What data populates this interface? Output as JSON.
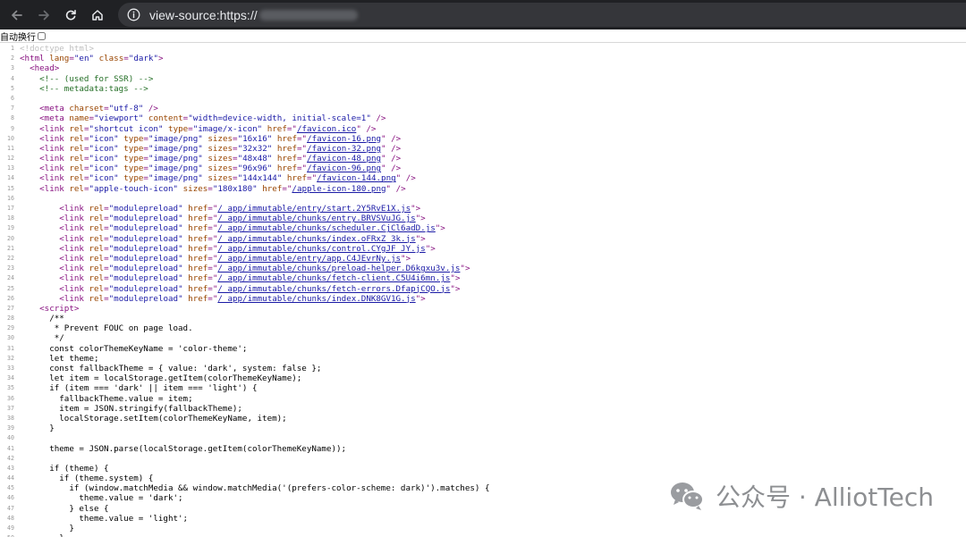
{
  "browser": {
    "url": "view-source:https://",
    "icons": {
      "back": "arrow-left-icon",
      "forward": "arrow-right-icon",
      "reload": "reload-icon",
      "home": "home-icon",
      "info": "info-icon"
    }
  },
  "wrap": {
    "label": "自动换行",
    "checked": false
  },
  "source_lines": [
    [
      [
        "d",
        "<!doctype html>"
      ]
    ],
    [
      [
        "t",
        "<html "
      ],
      [
        "a",
        "lang"
      ],
      [
        "t",
        "="
      ],
      [
        "v",
        "\"en\""
      ],
      [
        "t",
        " "
      ],
      [
        "a",
        "class"
      ],
      [
        "t",
        "="
      ],
      [
        "v",
        "\"dark\""
      ],
      [
        "t",
        ">"
      ]
    ],
    [
      [
        "",
        "  "
      ],
      [
        "t",
        "<head>"
      ]
    ],
    [
      [
        "",
        "    "
      ],
      [
        "c",
        "<!-- (used for SSR) -->"
      ]
    ],
    [
      [
        "",
        "    "
      ],
      [
        "c",
        "<!-- metadata:tags -->"
      ]
    ],
    [],
    [
      [
        "",
        "    "
      ],
      [
        "t",
        "<meta "
      ],
      [
        "a",
        "charset"
      ],
      [
        "t",
        "="
      ],
      [
        "v",
        "\"utf-8\""
      ],
      [
        "t",
        " />"
      ]
    ],
    [
      [
        "",
        "    "
      ],
      [
        "t",
        "<meta "
      ],
      [
        "a",
        "name"
      ],
      [
        "t",
        "="
      ],
      [
        "v",
        "\"viewport\""
      ],
      [
        "t",
        " "
      ],
      [
        "a",
        "content"
      ],
      [
        "t",
        "="
      ],
      [
        "v",
        "\"width=device-width, initial-scale=1\""
      ],
      [
        "t",
        " />"
      ]
    ],
    [
      [
        "",
        "    "
      ],
      [
        "t",
        "<link "
      ],
      [
        "a",
        "rel"
      ],
      [
        "t",
        "="
      ],
      [
        "v",
        "\"shortcut icon\""
      ],
      [
        "t",
        " "
      ],
      [
        "a",
        "type"
      ],
      [
        "t",
        "="
      ],
      [
        "v",
        "\"image/x-icon\""
      ],
      [
        "t",
        " "
      ],
      [
        "a",
        "href"
      ],
      [
        "t",
        "=\""
      ],
      [
        "lk",
        "/favicon.ico"
      ],
      [
        "t",
        "\" />"
      ]
    ],
    [
      [
        "",
        "    "
      ],
      [
        "t",
        "<link "
      ],
      [
        "a",
        "rel"
      ],
      [
        "t",
        "="
      ],
      [
        "v",
        "\"icon\""
      ],
      [
        "t",
        " "
      ],
      [
        "a",
        "type"
      ],
      [
        "t",
        "="
      ],
      [
        "v",
        "\"image/png\""
      ],
      [
        "t",
        " "
      ],
      [
        "a",
        "sizes"
      ],
      [
        "t",
        "="
      ],
      [
        "v",
        "\"16x16\""
      ],
      [
        "t",
        " "
      ],
      [
        "a",
        "href"
      ],
      [
        "t",
        "=\""
      ],
      [
        "lk",
        "/favicon-16.png"
      ],
      [
        "t",
        "\" />"
      ]
    ],
    [
      [
        "",
        "    "
      ],
      [
        "t",
        "<link "
      ],
      [
        "a",
        "rel"
      ],
      [
        "t",
        "="
      ],
      [
        "v",
        "\"icon\""
      ],
      [
        "t",
        " "
      ],
      [
        "a",
        "type"
      ],
      [
        "t",
        "="
      ],
      [
        "v",
        "\"image/png\""
      ],
      [
        "t",
        " "
      ],
      [
        "a",
        "sizes"
      ],
      [
        "t",
        "="
      ],
      [
        "v",
        "\"32x32\""
      ],
      [
        "t",
        " "
      ],
      [
        "a",
        "href"
      ],
      [
        "t",
        "=\""
      ],
      [
        "lk",
        "/favicon-32.png"
      ],
      [
        "t",
        "\" />"
      ]
    ],
    [
      [
        "",
        "    "
      ],
      [
        "t",
        "<link "
      ],
      [
        "a",
        "rel"
      ],
      [
        "t",
        "="
      ],
      [
        "v",
        "\"icon\""
      ],
      [
        "t",
        " "
      ],
      [
        "a",
        "type"
      ],
      [
        "t",
        "="
      ],
      [
        "v",
        "\"image/png\""
      ],
      [
        "t",
        " "
      ],
      [
        "a",
        "sizes"
      ],
      [
        "t",
        "="
      ],
      [
        "v",
        "\"48x48\""
      ],
      [
        "t",
        " "
      ],
      [
        "a",
        "href"
      ],
      [
        "t",
        "=\""
      ],
      [
        "lk",
        "/favicon-48.png"
      ],
      [
        "t",
        "\" />"
      ]
    ],
    [
      [
        "",
        "    "
      ],
      [
        "t",
        "<link "
      ],
      [
        "a",
        "rel"
      ],
      [
        "t",
        "="
      ],
      [
        "v",
        "\"icon\""
      ],
      [
        "t",
        " "
      ],
      [
        "a",
        "type"
      ],
      [
        "t",
        "="
      ],
      [
        "v",
        "\"image/png\""
      ],
      [
        "t",
        " "
      ],
      [
        "a",
        "sizes"
      ],
      [
        "t",
        "="
      ],
      [
        "v",
        "\"96x96\""
      ],
      [
        "t",
        " "
      ],
      [
        "a",
        "href"
      ],
      [
        "t",
        "=\""
      ],
      [
        "lk",
        "/favicon-96.png"
      ],
      [
        "t",
        "\" />"
      ]
    ],
    [
      [
        "",
        "    "
      ],
      [
        "t",
        "<link "
      ],
      [
        "a",
        "rel"
      ],
      [
        "t",
        "="
      ],
      [
        "v",
        "\"icon\""
      ],
      [
        "t",
        " "
      ],
      [
        "a",
        "type"
      ],
      [
        "t",
        "="
      ],
      [
        "v",
        "\"image/png\""
      ],
      [
        "t",
        " "
      ],
      [
        "a",
        "sizes"
      ],
      [
        "t",
        "="
      ],
      [
        "v",
        "\"144x144\""
      ],
      [
        "t",
        " "
      ],
      [
        "a",
        "href"
      ],
      [
        "t",
        "=\""
      ],
      [
        "lk",
        "/favicon-144.png"
      ],
      [
        "t",
        "\" />"
      ]
    ],
    [
      [
        "",
        "    "
      ],
      [
        "t",
        "<link "
      ],
      [
        "a",
        "rel"
      ],
      [
        "t",
        "="
      ],
      [
        "v",
        "\"apple-touch-icon\""
      ],
      [
        "t",
        " "
      ],
      [
        "a",
        "sizes"
      ],
      [
        "t",
        "="
      ],
      [
        "v",
        "\"180x180\""
      ],
      [
        "t",
        " "
      ],
      [
        "a",
        "href"
      ],
      [
        "t",
        "=\""
      ],
      [
        "lk",
        "/apple-icon-180.png"
      ],
      [
        "t",
        "\" />"
      ]
    ],
    [],
    [
      [
        "",
        "        "
      ],
      [
        "t",
        "<link "
      ],
      [
        "a",
        "rel"
      ],
      [
        "t",
        "="
      ],
      [
        "v",
        "\"modulepreload\""
      ],
      [
        "t",
        " "
      ],
      [
        "a",
        "href"
      ],
      [
        "t",
        "=\""
      ],
      [
        "lk",
        "/_app/immutable/entry/start.2Y5RvE1X.js"
      ],
      [
        "t",
        "\">"
      ]
    ],
    [
      [
        "",
        "        "
      ],
      [
        "t",
        "<link "
      ],
      [
        "a",
        "rel"
      ],
      [
        "t",
        "="
      ],
      [
        "v",
        "\"modulepreload\""
      ],
      [
        "t",
        " "
      ],
      [
        "a",
        "href"
      ],
      [
        "t",
        "=\""
      ],
      [
        "lk",
        "/_app/immutable/chunks/entry.BRVSVuJG.js"
      ],
      [
        "t",
        "\">"
      ]
    ],
    [
      [
        "",
        "        "
      ],
      [
        "t",
        "<link "
      ],
      [
        "a",
        "rel"
      ],
      [
        "t",
        "="
      ],
      [
        "v",
        "\"modulepreload\""
      ],
      [
        "t",
        " "
      ],
      [
        "a",
        "href"
      ],
      [
        "t",
        "=\""
      ],
      [
        "lk",
        "/_app/immutable/chunks/scheduler.CjCl6adD.js"
      ],
      [
        "t",
        "\">"
      ]
    ],
    [
      [
        "",
        "        "
      ],
      [
        "t",
        "<link "
      ],
      [
        "a",
        "rel"
      ],
      [
        "t",
        "="
      ],
      [
        "v",
        "\"modulepreload\""
      ],
      [
        "t",
        " "
      ],
      [
        "a",
        "href"
      ],
      [
        "t",
        "=\""
      ],
      [
        "lk",
        "/_app/immutable/chunks/index.oFRxZ_3k.js"
      ],
      [
        "t",
        "\">"
      ]
    ],
    [
      [
        "",
        "        "
      ],
      [
        "t",
        "<link "
      ],
      [
        "a",
        "rel"
      ],
      [
        "t",
        "="
      ],
      [
        "v",
        "\"modulepreload\""
      ],
      [
        "t",
        " "
      ],
      [
        "a",
        "href"
      ],
      [
        "t",
        "=\""
      ],
      [
        "lk",
        "/_app/immutable/chunks/control.CYgJF_JY.js"
      ],
      [
        "t",
        "\">"
      ]
    ],
    [
      [
        "",
        "        "
      ],
      [
        "t",
        "<link "
      ],
      [
        "a",
        "rel"
      ],
      [
        "t",
        "="
      ],
      [
        "v",
        "\"modulepreload\""
      ],
      [
        "t",
        " "
      ],
      [
        "a",
        "href"
      ],
      [
        "t",
        "=\""
      ],
      [
        "lk",
        "/_app/immutable/entry/app.C4JEvrNy.js"
      ],
      [
        "t",
        "\">"
      ]
    ],
    [
      [
        "",
        "        "
      ],
      [
        "t",
        "<link "
      ],
      [
        "a",
        "rel"
      ],
      [
        "t",
        "="
      ],
      [
        "v",
        "\"modulepreload\""
      ],
      [
        "t",
        " "
      ],
      [
        "a",
        "href"
      ],
      [
        "t",
        "=\""
      ],
      [
        "lk",
        "/_app/immutable/chunks/preload-helper.D6kgxu3v.js"
      ],
      [
        "t",
        "\">"
      ]
    ],
    [
      [
        "",
        "        "
      ],
      [
        "t",
        "<link "
      ],
      [
        "a",
        "rel"
      ],
      [
        "t",
        "="
      ],
      [
        "v",
        "\"modulepreload\""
      ],
      [
        "t",
        " "
      ],
      [
        "a",
        "href"
      ],
      [
        "t",
        "=\""
      ],
      [
        "lk",
        "/_app/immutable/chunks/fetch-client.C5U4i6mn.js"
      ],
      [
        "t",
        "\">"
      ]
    ],
    [
      [
        "",
        "        "
      ],
      [
        "t",
        "<link "
      ],
      [
        "a",
        "rel"
      ],
      [
        "t",
        "="
      ],
      [
        "v",
        "\"modulepreload\""
      ],
      [
        "t",
        " "
      ],
      [
        "a",
        "href"
      ],
      [
        "t",
        "=\""
      ],
      [
        "lk",
        "/_app/immutable/chunks/fetch-errors.DfapjCQO.js"
      ],
      [
        "t",
        "\">"
      ]
    ],
    [
      [
        "",
        "        "
      ],
      [
        "t",
        "<link "
      ],
      [
        "a",
        "rel"
      ],
      [
        "t",
        "="
      ],
      [
        "v",
        "\"modulepreload\""
      ],
      [
        "t",
        " "
      ],
      [
        "a",
        "href"
      ],
      [
        "t",
        "=\""
      ],
      [
        "lk",
        "/_app/immutable/chunks/index.DNK8GV1G.js"
      ],
      [
        "t",
        "\">"
      ]
    ],
    [
      [
        "",
        "    "
      ],
      [
        "t",
        "<script>"
      ]
    ],
    [
      [
        "",
        "      /**"
      ]
    ],
    [
      [
        "",
        "       * Prevent FOUC on page load."
      ]
    ],
    [
      [
        "",
        "       */"
      ]
    ],
    [
      [
        "",
        "      const colorThemeKeyName = 'color-theme';"
      ]
    ],
    [
      [
        "",
        "      let theme;"
      ]
    ],
    [
      [
        "",
        "      const fallbackTheme = { value: 'dark', system: false };"
      ]
    ],
    [
      [
        "",
        "      let item = localStorage.getItem(colorThemeKeyName);"
      ]
    ],
    [
      [
        "",
        "      if (item === 'dark' || item === 'light') {"
      ]
    ],
    [
      [
        "",
        "        fallbackTheme.value = item;"
      ]
    ],
    [
      [
        "",
        "        item = JSON.stringify(fallbackTheme);"
      ]
    ],
    [
      [
        "",
        "        localStorage.setItem(colorThemeKeyName, item);"
      ]
    ],
    [
      [
        "",
        "      }"
      ]
    ],
    [],
    [
      [
        "",
        "      theme = JSON.parse(localStorage.getItem(colorThemeKeyName));"
      ]
    ],
    [],
    [
      [
        "",
        "      if (theme) {"
      ]
    ],
    [
      [
        "",
        "        if (theme.system) {"
      ]
    ],
    [
      [
        "",
        "          if (window.matchMedia && window.matchMedia('(prefers-color-scheme: dark)').matches) {"
      ]
    ],
    [
      [
        "",
        "            theme.value = 'dark';"
      ]
    ],
    [
      [
        "",
        "          } else {"
      ]
    ],
    [
      [
        "",
        "            theme.value = 'light';"
      ]
    ],
    [
      [
        "",
        "          }"
      ]
    ],
    [
      [
        "",
        "        }"
      ]
    ]
  ],
  "watermark": {
    "text": "公众号 · AlliotTech",
    "icon": "wechat-icon"
  }
}
